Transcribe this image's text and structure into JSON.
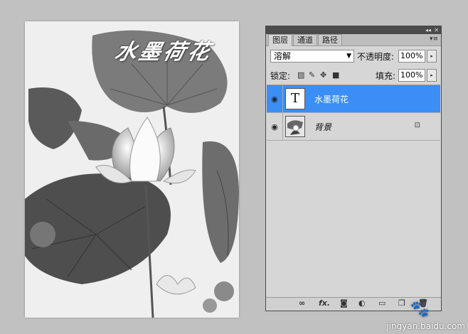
{
  "canvas": {
    "title_text": "水墨荷花"
  },
  "layers_panel": {
    "tabs": [
      {
        "label": "图层",
        "active": true
      },
      {
        "label": "通道",
        "active": false
      },
      {
        "label": "路径",
        "active": false
      }
    ],
    "collapse_icon": "double-chevron",
    "close_icon": "close",
    "menu_icon": "panel-menu",
    "blend_mode": "溶解",
    "opacity_label": "不透明度:",
    "opacity_value": "100%",
    "lock_label": "锁定:",
    "fill_label": "填充:",
    "fill_value": "100%",
    "layers": [
      {
        "name": "水墨荷花",
        "type": "text",
        "thumb": "T",
        "selected": true,
        "visible": true,
        "locked": false
      },
      {
        "name": "背景",
        "type": "image",
        "selected": false,
        "visible": true,
        "locked": true
      }
    ],
    "bottom_icons": [
      "link",
      "fx",
      "mask",
      "adjustment",
      "group",
      "new-layer",
      "trash"
    ],
    "fx_label": "fx."
  },
  "watermark": {
    "text": "jingyan.baidu.com"
  },
  "colors": {
    "selection": "#3a8ef6",
    "background": "#c1c1c1"
  }
}
